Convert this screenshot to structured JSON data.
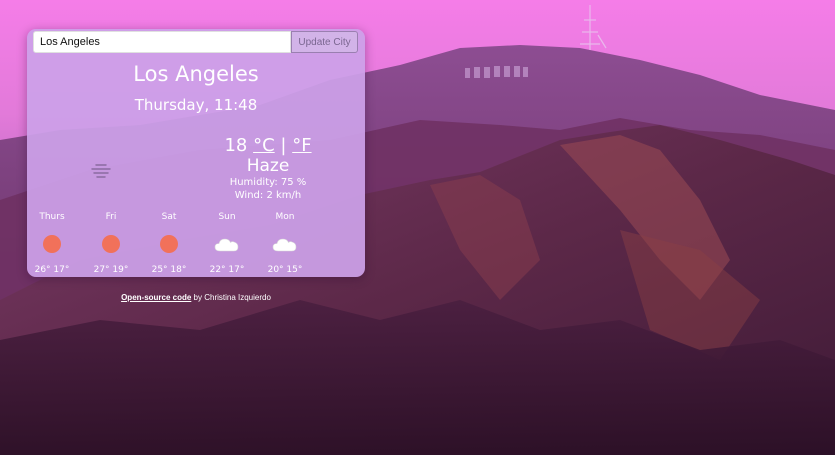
{
  "search": {
    "value": "Los Angeles",
    "button_label": "Update City"
  },
  "weather": {
    "city": "Los Angeles",
    "datetime": "Thursday, 11:48",
    "temperature": "18",
    "unit_celsius": "°C",
    "unit_separator": "|",
    "unit_fahrenheit": "°F",
    "description": "Haze",
    "humidity": "Humidity: 75 %",
    "wind": "Wind: 2 km/h",
    "icon": "haze-icon"
  },
  "forecast": [
    {
      "day": "Thurs",
      "temps": "26° 17°",
      "icon": "sun-icon"
    },
    {
      "day": "Fri",
      "temps": "27° 19°",
      "icon": "sun-icon"
    },
    {
      "day": "Sat",
      "temps": "25° 18°",
      "icon": "sun-icon"
    },
    {
      "day": "Sun",
      "temps": "22° 17°",
      "icon": "cloud-icon"
    },
    {
      "day": "Mon",
      "temps": "20° 15°",
      "icon": "cloud-icon"
    }
  ],
  "footer": {
    "link_text": "Open-source code",
    "suffix": " by Christina Izquierdo"
  },
  "colors": {
    "sun": "#f1715a",
    "cloud": "#ffffff",
    "card": "#cca0e8"
  }
}
